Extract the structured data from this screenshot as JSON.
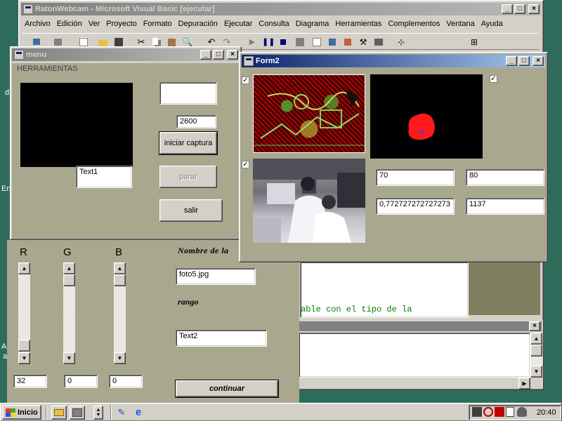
{
  "vb_ide": {
    "title": "RatonWebcam - Microsoft Visual Basic [ejecutar]",
    "menu": [
      "Archivo",
      "Edición",
      "Ver",
      "Proyecto",
      "Formato",
      "Depuración",
      "Ejecutar",
      "Consulta",
      "Diagrama",
      "Herramientas",
      "Complementos",
      "Ventana",
      "Ayuda"
    ],
    "code_text": "able con el tipo de la"
  },
  "desktop_fragments": {
    "d": "d",
    "en": "En",
    "ac": "Ac",
    "a": "a"
  },
  "menu_form": {
    "title": "menu",
    "herramientas_label": "HERRAMIENTAS",
    "text1_value": "Text1",
    "blank_field": "",
    "interval_value": "2600",
    "start_button": "iniciar captura",
    "stop_button": "parar",
    "exit_button": "salir",
    "r_label": "R",
    "g_label": "G",
    "b_label": "B",
    "r_value": "32",
    "g_value": "0",
    "b_value": "0",
    "filename_label": "Nombre de la",
    "filename_value": "foto5.jpg",
    "range_label": "rango",
    "range_value": "Text2",
    "continue_button": "continuar"
  },
  "form2": {
    "title": "Form2",
    "check_top_left": "✓",
    "check_top_right": "✓",
    "check_bottom_left": "✓",
    "value_x": "70",
    "value_y": "80",
    "value_ratio": "0,772727272727273",
    "value_count": "1137"
  },
  "taskbar": {
    "start_label": "Inicio",
    "clock": "20:40"
  },
  "colors": {
    "desktop": "#2f6b5b",
    "face": "#d4d0c8",
    "active_title": "#0a246a",
    "inactive_title": "#808080",
    "blob": "#ff1a1a"
  }
}
